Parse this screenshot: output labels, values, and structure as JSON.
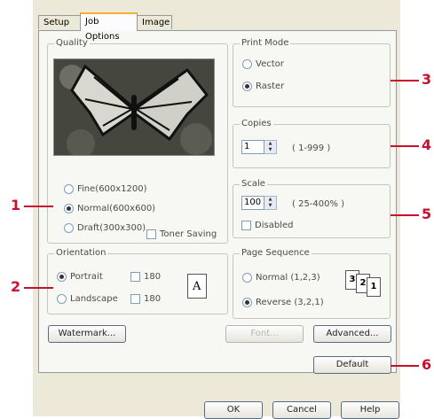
{
  "tabs": [
    "Setup",
    "Job Options",
    "Image"
  ],
  "quality": {
    "title": "Quality",
    "options": [
      "Fine(600x1200)",
      "Normal(600x600)",
      "Draft(300x300)"
    ],
    "selected": 1,
    "toner_saving": "Toner Saving"
  },
  "print_mode": {
    "title": "Print Mode",
    "options": [
      "Vector",
      "Raster"
    ],
    "selected": 1
  },
  "copies": {
    "title": "Copies",
    "value": "1",
    "range": "( 1-999 )"
  },
  "scale": {
    "title": "Scale",
    "value": "100",
    "range": "( 25-400% )",
    "disabled_label": "Disabled"
  },
  "orientation": {
    "title": "Orientation",
    "options": [
      "Portrait",
      "Landscape"
    ],
    "selected": 0,
    "rotate_label": "180",
    "page_icon_letter": "A"
  },
  "page_sequence": {
    "title": "Page Sequence",
    "options": [
      "Normal (1,2,3)",
      "Reverse (3,2,1)"
    ],
    "selected": 1,
    "icon_digits": [
      "3",
      "2",
      "1"
    ]
  },
  "buttons": {
    "watermark": "Watermark...",
    "font": "Font...",
    "advanced": "Advanced...",
    "default": "Default",
    "ok": "OK",
    "cancel": "Cancel",
    "help": "Help"
  },
  "callouts": [
    "1",
    "2",
    "3",
    "4",
    "5",
    "6"
  ],
  "colors": {
    "callout": "#c8102e",
    "tab_accent": "#f7b030"
  }
}
